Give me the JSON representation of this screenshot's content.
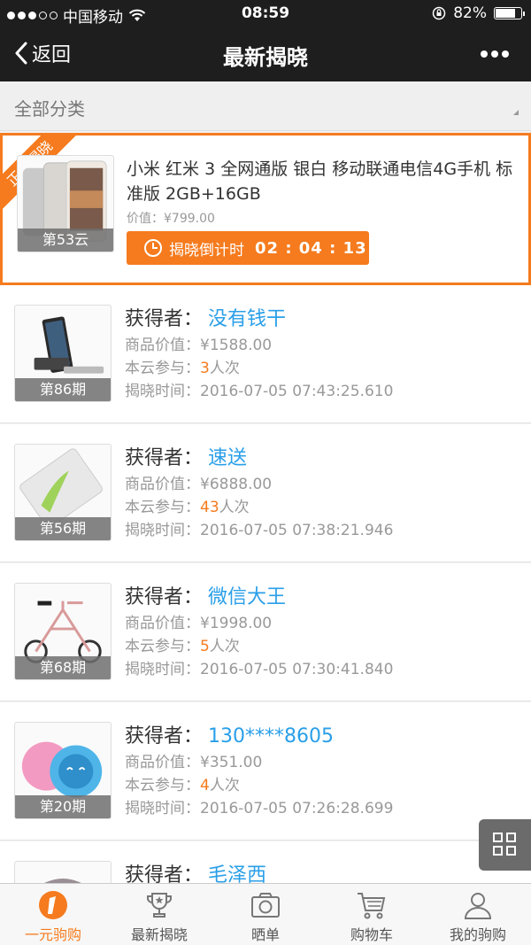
{
  "status_bar": {
    "carrier": "中国移动",
    "time": "08:59",
    "battery": "82%",
    "battery_level": 0.82
  },
  "nav": {
    "back_label": "返回",
    "title": "最新揭晓"
  },
  "filter": {
    "label": "全部分类"
  },
  "featured": {
    "ribbon": "正在揭晓",
    "name": "小米 红米 3 全网通版 银白 移动联通电信4G手机 标准版 2GB+16GB",
    "price": "价值：¥799.00",
    "period": "第53云",
    "countdown_label": "揭晓倒计时",
    "countdown_value": "02 : 04 : 13"
  },
  "labels": {
    "winner": "获得者：",
    "value": "商品价值：",
    "join": "本云参与：",
    "time": "揭晓时间：",
    "unit": "人次"
  },
  "items": [
    {
      "period": "第86期",
      "winner": "没有钱干",
      "value": "¥1588.00",
      "count": "3",
      "time": "2016-07-05 07:43:25.610"
    },
    {
      "period": "第56期",
      "winner": "速送",
      "value": "¥6888.00",
      "count": "43",
      "time": "2016-07-05 07:38:21.946"
    },
    {
      "period": "第68期",
      "winner": "微信大王",
      "value": "¥1998.00",
      "count": "5",
      "time": "2016-07-05 07:30:41.840"
    },
    {
      "period": "第20期",
      "winner": "130****8605",
      "value": "¥351.00",
      "count": "4",
      "time": "2016-07-05 07:26:28.699"
    },
    {
      "period": "",
      "winner": "毛泽西",
      "value": "",
      "count": "",
      "time": ""
    }
  ],
  "tabs": [
    {
      "label": "一元驹购",
      "icon": "logo-one-icon",
      "active": true
    },
    {
      "label": "最新揭晓",
      "icon": "trophy-icon",
      "active": false
    },
    {
      "label": "晒单",
      "icon": "camera-icon",
      "active": false
    },
    {
      "label": "购物车",
      "icon": "cart-icon",
      "active": false
    },
    {
      "label": "我的驹购",
      "icon": "user-icon",
      "active": false
    }
  ],
  "colors": {
    "accent": "#f57b1e",
    "winner_name": "#2a9fe8",
    "header": "#1e1e1e"
  }
}
